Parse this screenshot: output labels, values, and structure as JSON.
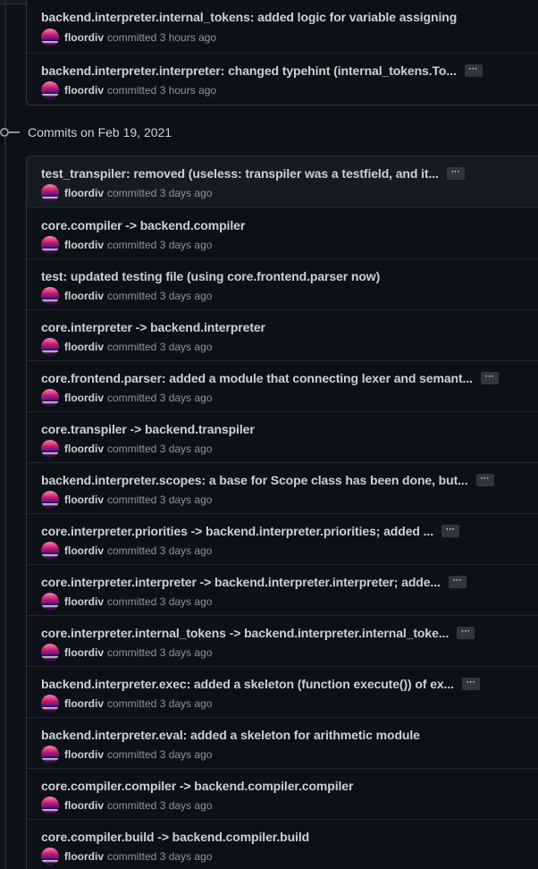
{
  "groups": [
    {
      "heading": "",
      "commits": [
        {
          "message": "backend.interpreter.internal_tokens: added logic for variable assigning",
          "has_more": false,
          "author": "floordiv",
          "action": "committed",
          "time": "3 hours ago"
        },
        {
          "message": "backend.interpreter.interpreter: changed typehint (internal_tokens.To...",
          "has_more": true,
          "author": "floordiv",
          "action": "committed",
          "time": "3 hours ago"
        }
      ]
    },
    {
      "heading": "Commits on Feb 19, 2021",
      "commits": [
        {
          "message": "test_transpiler: removed (useless: transpiler was a testfield, and it...",
          "has_more": true,
          "author": "floordiv",
          "action": "committed",
          "time": "3 days ago"
        },
        {
          "message": "core.compiler -> backend.compiler",
          "has_more": false,
          "author": "floordiv",
          "action": "committed",
          "time": "3 days ago"
        },
        {
          "message": "test: updated testing file (using core.frontend.parser now)",
          "has_more": false,
          "author": "floordiv",
          "action": "committed",
          "time": "3 days ago"
        },
        {
          "message": "core.interpreter -> backend.interpreter",
          "has_more": false,
          "author": "floordiv",
          "action": "committed",
          "time": "3 days ago"
        },
        {
          "message": "core.frontend.parser: added a module that connecting lexer and semant...",
          "has_more": true,
          "author": "floordiv",
          "action": "committed",
          "time": "3 days ago"
        },
        {
          "message": "core.transpiler -> backend.transpiler",
          "has_more": false,
          "author": "floordiv",
          "action": "committed",
          "time": "3 days ago"
        },
        {
          "message": "backend.interpreter.scopes: a base for Scope class has been done, but...",
          "has_more": true,
          "author": "floordiv",
          "action": "committed",
          "time": "3 days ago"
        },
        {
          "message": "core.interpreter.priorities -> backend.interpreter.priorities; added ...",
          "has_more": true,
          "author": "floordiv",
          "action": "committed",
          "time": "3 days ago"
        },
        {
          "message": "core.interpreter.interpreter -> backend.interpreter.interpreter; adde...",
          "has_more": true,
          "author": "floordiv",
          "action": "committed",
          "time": "3 days ago"
        },
        {
          "message": "core.interpreter.internal_tokens -> backend.interpreter.internal_toke...",
          "has_more": true,
          "author": "floordiv",
          "action": "committed",
          "time": "3 days ago"
        },
        {
          "message": "backend.interpreter.exec: added a skeleton (function execute()) of ex...",
          "has_more": true,
          "author": "floordiv",
          "action": "committed",
          "time": "3 days ago"
        },
        {
          "message": "backend.interpreter.eval: added a skeleton for arithmetic module",
          "has_more": false,
          "author": "floordiv",
          "action": "committed",
          "time": "3 days ago"
        },
        {
          "message": "core.compiler.compiler -> backend.compiler.compiler",
          "has_more": false,
          "author": "floordiv",
          "action": "committed",
          "time": "3 days ago"
        },
        {
          "message": "core.compiler.build -> backend.compiler.build",
          "has_more": false,
          "author": "floordiv",
          "action": "committed",
          "time": "3 days ago"
        }
      ]
    }
  ],
  "ellipsis_label": "···",
  "colors": {
    "background": "#0d1117",
    "border": "#30363d",
    "text": "#c9d1d9",
    "muted": "#8b949e"
  }
}
